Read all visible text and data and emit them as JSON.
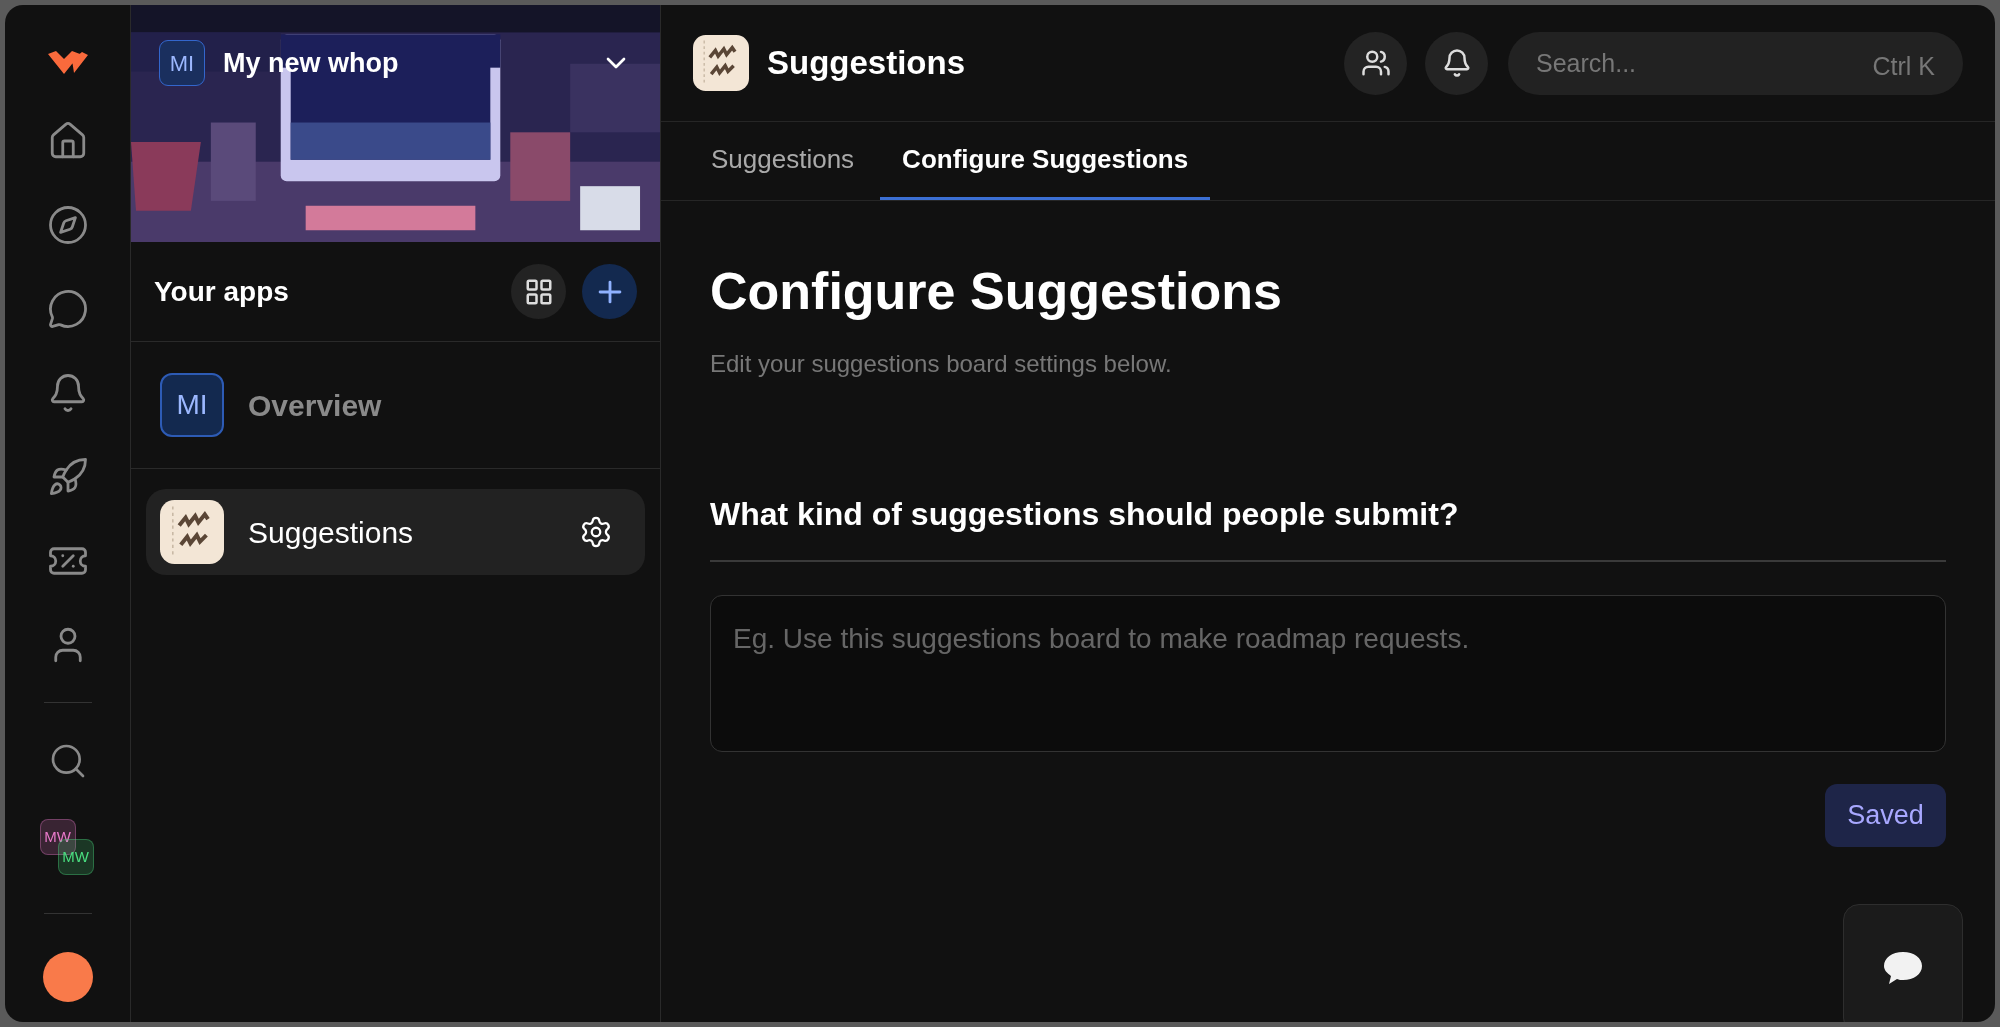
{
  "rail": {
    "nav": [
      {
        "kind": "home",
        "selected": false
      },
      {
        "kind": "compass",
        "selected": false
      },
      {
        "kind": "chat",
        "selected": false
      },
      {
        "kind": "bell",
        "selected": false
      },
      {
        "kind": "rocket",
        "selected": false
      },
      {
        "kind": "ticket",
        "selected": false
      },
      {
        "kind": "user",
        "selected": false
      }
    ],
    "workspaces": [
      {
        "initials": "MW",
        "color": "#e879c9"
      },
      {
        "initials": "MW",
        "color": "#4ade80"
      }
    ]
  },
  "sidebar": {
    "workspace": {
      "initials": "MI",
      "name": "My new whop"
    },
    "apps_title": "Your apps",
    "items": [
      {
        "kind": "initials",
        "initials": "MI",
        "label": "Overview",
        "selected": false
      },
      {
        "kind": "app",
        "label": "Suggestions",
        "selected": true
      }
    ]
  },
  "header": {
    "title": "Suggestions",
    "search": {
      "placeholder": "Search...",
      "shortcut": "Ctrl K"
    }
  },
  "tabs": [
    {
      "label": "Suggestions",
      "selected": false
    },
    {
      "label": "Configure Suggestions",
      "selected": true
    }
  ],
  "page": {
    "title": "Configure Suggestions",
    "subtitle": "Edit your suggestions board settings below.",
    "question": "What kind of suggestions should people submit?",
    "placeholder": "Eg. Use this suggestions board to make roadmap requests.",
    "save_button": "Saved"
  }
}
